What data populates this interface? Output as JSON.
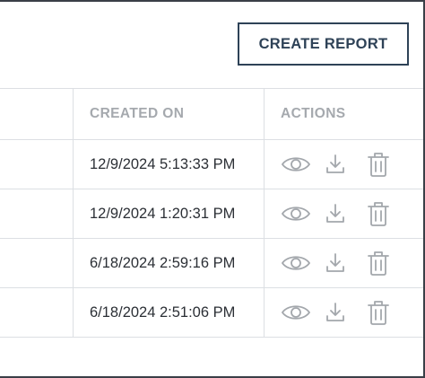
{
  "toolbar": {
    "create_report_label": "CREATE REPORT"
  },
  "table": {
    "columns": [
      "",
      "CREATED ON",
      "ACTIONS"
    ],
    "rows": [
      {
        "created_on": "12/9/2024 5:13:33 PM"
      },
      {
        "created_on": "12/9/2024 1:20:31 PM"
      },
      {
        "created_on": "6/18/2024 2:59:16 PM"
      },
      {
        "created_on": "6/18/2024 2:51:06 PM"
      }
    ],
    "row_actions": [
      "eye-icon",
      "download-icon",
      "trash-icon"
    ]
  },
  "colors": {
    "accent": "#2e4257",
    "header_text": "#a5a9ae",
    "icon": "#a3a7ac",
    "border": "#dcdfe3"
  }
}
